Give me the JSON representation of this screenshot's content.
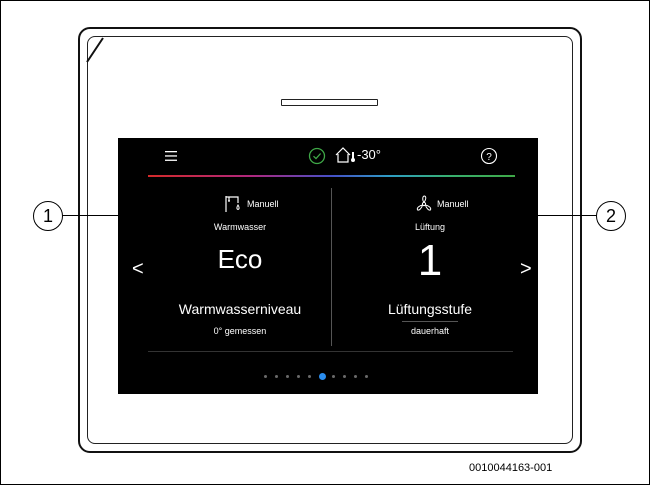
{
  "status_bar": {
    "menu_icon": "hamburger-menu-icon",
    "ok_icon": "check-circle-icon",
    "house_icon": "house-thermometer-icon",
    "outdoor_temp": "-30°",
    "help_icon": "question-circle-icon",
    "colors": [
      "#d42a2a",
      "#b0287e",
      "#4550c8",
      "#2e9ec4",
      "#38b070",
      "#3fa847"
    ]
  },
  "left_panel": {
    "icon": "faucet-icon",
    "mode": "Manuell",
    "label": "Warmwasser",
    "value": "Eco",
    "sub_label": "Warmwasserniveau",
    "sub_value": "0° gemessen"
  },
  "right_panel": {
    "icon": "fan-icon",
    "mode": "Manuell",
    "label": "Lüftung",
    "value": "1",
    "sub_label": "Lüftungsstufe",
    "sub_value": "dauerhaft"
  },
  "navigation": {
    "prev": "<",
    "next": ">"
  },
  "page_indicator": {
    "count": 10,
    "active_index": 5,
    "active_color": "#2b8ef0"
  },
  "callouts": {
    "left": "1",
    "right": "2"
  },
  "document_id": "0010044163-001"
}
